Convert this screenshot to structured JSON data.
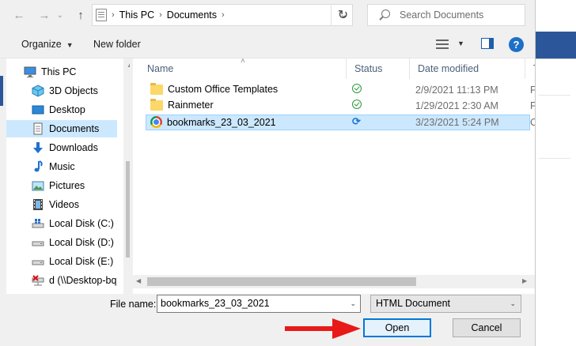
{
  "address_bar": {
    "breadcrumb": [
      "This PC",
      "Documents"
    ],
    "search_placeholder": "Search Documents"
  },
  "toolbar": {
    "organize_label": "Organize",
    "new_folder_label": "New folder",
    "help_label": "?"
  },
  "nav_pane": {
    "items": [
      {
        "label": "This PC",
        "icon": "computer-icon"
      },
      {
        "label": "3D Objects",
        "icon": "cube-icon"
      },
      {
        "label": "Desktop",
        "icon": "desktop-icon"
      },
      {
        "label": "Documents",
        "icon": "document-icon",
        "selected": true
      },
      {
        "label": "Downloads",
        "icon": "download-arrow-icon"
      },
      {
        "label": "Music",
        "icon": "music-note-icon"
      },
      {
        "label": "Pictures",
        "icon": "picture-icon"
      },
      {
        "label": "Videos",
        "icon": "film-icon"
      },
      {
        "label": "Local Disk (C:)",
        "icon": "drive-windows-icon"
      },
      {
        "label": "Local Disk (D:)",
        "icon": "drive-icon"
      },
      {
        "label": "Local Disk (E:)",
        "icon": "drive-icon"
      },
      {
        "label": "d (\\\\Desktop-bq",
        "icon": "network-drive-disconnected-icon"
      }
    ]
  },
  "file_list": {
    "columns": [
      "Name",
      "Status",
      "Date modified",
      "T"
    ],
    "rows": [
      {
        "name": "Custom Office Templates",
        "type_icon": "folder-icon",
        "status_icon": "synced-check-icon",
        "date": "2/9/2021 11:13 PM",
        "type": "F"
      },
      {
        "name": "Rainmeter",
        "type_icon": "folder-icon",
        "status_icon": "synced-check-icon",
        "date": "1/29/2021 2:30 AM",
        "type": "F"
      },
      {
        "name": "bookmarks_23_03_2021",
        "type_icon": "chrome-icon",
        "status_icon": "syncing-icon",
        "date": "3/23/2021 5:24 PM",
        "type": "C",
        "selected": true
      }
    ]
  },
  "bottom": {
    "file_name_label": "File name:",
    "file_name_value": "bookmarks_23_03_2021",
    "file_type_value": "HTML Document",
    "open_label": "Open",
    "cancel_label": "Cancel"
  },
  "colors": {
    "selection_bg": "#cce8ff",
    "accent_blue": "#0078d7",
    "annotation_arrow": "#e81919"
  }
}
